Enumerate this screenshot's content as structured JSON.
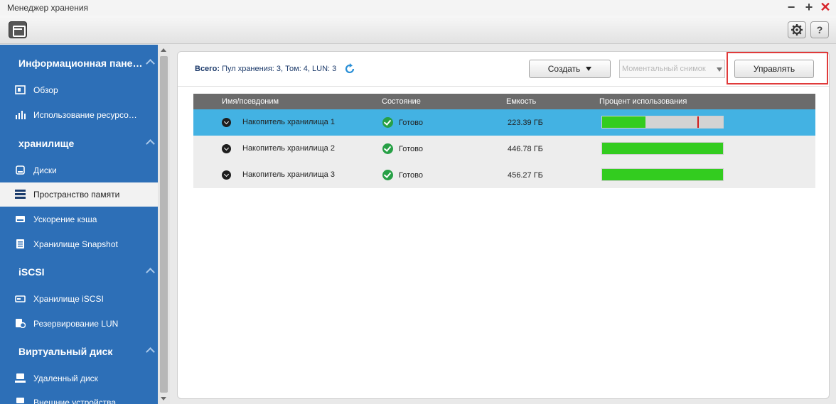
{
  "window": {
    "title": "Менеджер хранения",
    "minimize_label": "−",
    "maximize_label": "+",
    "close_label": "✕"
  },
  "toolbar": {
    "help_label": "?"
  },
  "sidebar": {
    "sections": [
      {
        "title": "Информационная пане…",
        "items": [
          "Обзор",
          "Использование ресурсо…"
        ]
      },
      {
        "title": "хранилище",
        "items": [
          "Диски",
          "Пространство памяти",
          "Ускорение кэша",
          "Хранилище Snapshot"
        ]
      },
      {
        "title": "iSCSI",
        "items": [
          "Хранилище iSCSI",
          "Резервирование LUN"
        ]
      },
      {
        "title": "Виртуальный диск",
        "items": [
          "Удаленный диск",
          "Внешние устройства"
        ]
      }
    ],
    "active_item": "Пространство памяти"
  },
  "summary": {
    "label": "Всего:",
    "text": "Пул хранения: 3, Том:  4, LUN: 3"
  },
  "actions": {
    "create_label": "Создать",
    "snapshot_placeholder": "Моментальный снимок",
    "manage_label": "Управлять"
  },
  "table": {
    "columns": [
      "Имя/псевдоним",
      "Состояние",
      "Емкость",
      "Процент использования"
    ],
    "rows": [
      {
        "name": "Накопитель хранилища 1",
        "status": "Готово",
        "capacity": "223.39 ГБ",
        "usage_percent": 36,
        "threshold_percent": 79,
        "selected": true
      },
      {
        "name": "Накопитель хранилища 2",
        "status": "Готово",
        "capacity": "446.78 ГБ",
        "usage_percent": 100,
        "selected": false
      },
      {
        "name": "Накопитель хранилища 3",
        "status": "Готово",
        "capacity": "456.27 ГБ",
        "usage_percent": 100,
        "selected": false
      }
    ]
  },
  "colors": {
    "sidebar_bg": "#2d6fb7",
    "selected_row": "#43b2e3",
    "usage_fill": "#33cc1f",
    "threshold": "#d01c1c",
    "highlight": "#e03a3a"
  }
}
